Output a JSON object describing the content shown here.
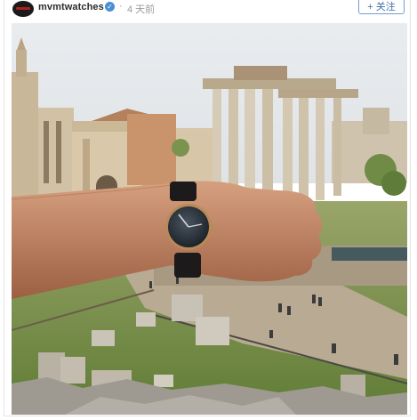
{
  "post": {
    "username": "mvmtwatches",
    "verified_icon": "verified-check-icon",
    "separator": "·",
    "time_ago": "4 天前",
    "follow_label": "+ 关注"
  },
  "photo": {
    "subject": "wrist-watch-photo"
  }
}
